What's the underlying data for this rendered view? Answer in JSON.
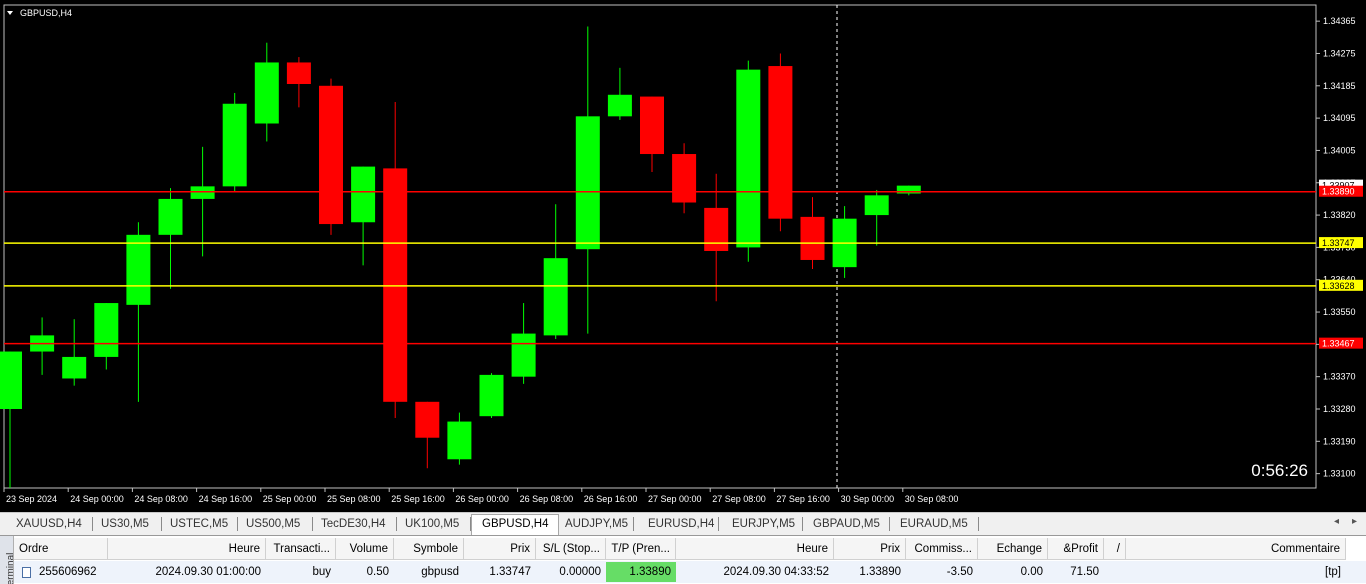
{
  "chart": {
    "symbol_title": "GBPUSD,H4",
    "countdown": "0:56:26",
    "colors": {
      "bull": "#00ff00",
      "bear": "#ff0000",
      "background": "#000000",
      "grid_text": "#ffffff",
      "hline_red": "#ff0000",
      "hline_yellow": "#ffff00"
    },
    "price_labels": [
      "1.34365",
      "1.34275",
      "1.34185",
      "1.34095",
      "1.34005",
      "1.33907",
      "1.33820",
      "1.33730",
      "1.33640",
      "1.33550",
      "1.33460",
      "1.33370",
      "1.33280",
      "1.33190",
      "1.33100"
    ],
    "time_labels": [
      "23 Sep 2024",
      "24 Sep 00:00",
      "24 Sep 08:00",
      "24 Sep 16:00",
      "25 Sep 00:00",
      "25 Sep 08:00",
      "25 Sep 16:00",
      "26 Sep 00:00",
      "26 Sep 08:00",
      "26 Sep 16:00",
      "27 Sep 00:00",
      "27 Sep 08:00",
      "27 Sep 16:00",
      "30 Sep 00:00",
      "30 Sep 08:00"
    ],
    "hlines": [
      {
        "price": 1.3389,
        "label": "1.33890",
        "color": "red"
      },
      {
        "price": 1.33747,
        "label": "1.33747",
        "color": "yellow"
      },
      {
        "price": 1.33628,
        "label": "1.33628",
        "color": "yellow"
      },
      {
        "price": 1.33467,
        "label": "1.33467",
        "color": "red"
      }
    ],
    "current_price_label": "1.33907",
    "candles": [
      {
        "o": 1.33285,
        "h": 1.33445,
        "l": 1.33065,
        "c": 1.33445
      },
      {
        "o": 1.33445,
        "h": 1.3354,
        "l": 1.3338,
        "c": 1.3349
      },
      {
        "o": 1.3337,
        "h": 1.33535,
        "l": 1.3335,
        "c": 1.3343
      },
      {
        "o": 1.3343,
        "h": 1.3358,
        "l": 1.33395,
        "c": 1.3358
      },
      {
        "o": 1.33575,
        "h": 1.33805,
        "l": 1.33305,
        "c": 1.3377
      },
      {
        "o": 1.3377,
        "h": 1.339,
        "l": 1.3362,
        "c": 1.3387
      },
      {
        "o": 1.3387,
        "h": 1.34015,
        "l": 1.3371,
        "c": 1.33905
      },
      {
        "o": 1.33905,
        "h": 1.34165,
        "l": 1.3389,
        "c": 1.34135
      },
      {
        "o": 1.3408,
        "h": 1.34305,
        "l": 1.3403,
        "c": 1.3425
      },
      {
        "o": 1.3425,
        "h": 1.34265,
        "l": 1.34125,
        "c": 1.3419
      },
      {
        "o": 1.34185,
        "h": 1.34205,
        "l": 1.3377,
        "c": 1.338
      },
      {
        "o": 1.33805,
        "h": 1.3396,
        "l": 1.33685,
        "c": 1.3396
      },
      {
        "o": 1.33955,
        "h": 1.3414,
        "l": 1.3326,
        "c": 1.33305
      },
      {
        "o": 1.33305,
        "h": 1.33305,
        "l": 1.3312,
        "c": 1.33205
      },
      {
        "o": 1.33145,
        "h": 1.33275,
        "l": 1.3313,
        "c": 1.3325
      },
      {
        "o": 1.33265,
        "h": 1.33385,
        "l": 1.3326,
        "c": 1.3338
      },
      {
        "o": 1.33375,
        "h": 1.3358,
        "l": 1.33355,
        "c": 1.33495
      },
      {
        "o": 1.3349,
        "h": 1.33855,
        "l": 1.3348,
        "c": 1.33705
      },
      {
        "o": 1.3373,
        "h": 1.3435,
        "l": 1.33495,
        "c": 1.341
      },
      {
        "o": 1.341,
        "h": 1.34235,
        "l": 1.3409,
        "c": 1.3416
      },
      {
        "o": 1.34155,
        "h": 1.34155,
        "l": 1.33945,
        "c": 1.33995
      },
      {
        "o": 1.33995,
        "h": 1.34025,
        "l": 1.3383,
        "c": 1.3386
      },
      {
        "o": 1.33845,
        "h": 1.3394,
        "l": 1.33585,
        "c": 1.33725
      },
      {
        "o": 1.33735,
        "h": 1.34255,
        "l": 1.33695,
        "c": 1.3423
      },
      {
        "o": 1.3424,
        "h": 1.34275,
        "l": 1.3378,
        "c": 1.33815
      },
      {
        "o": 1.3382,
        "h": 1.33875,
        "l": 1.33675,
        "c": 1.337
      },
      {
        "o": 1.3368,
        "h": 1.3385,
        "l": 1.3365,
        "c": 1.33815
      },
      {
        "o": 1.33825,
        "h": 1.33895,
        "l": 1.3374,
        "c": 1.3388
      },
      {
        "o": 1.33885,
        "h": 1.33907,
        "l": 1.3388,
        "c": 1.33907
      }
    ]
  },
  "tabs": [
    "XAUUSD,H4",
    "US30,M5",
    "USTEC,M5",
    "US500,M5",
    "TecDE30,H4",
    "UK100,M5",
    "GBPUSD,H4",
    "AUDJPY,M5",
    "EURUSD,H4",
    "EURJPY,M5",
    "GBPAUD,M5",
    "EURAUD,M5"
  ],
  "active_tab": "GBPUSD,H4",
  "terminal": {
    "side_label": "Terminal",
    "headers": [
      "Ordre",
      "Heure",
      "Transacti...",
      "Volume",
      "Symbole",
      "Prix",
      "S/L (Stop...",
      "T/P (Pren...",
      "Heure",
      "Prix",
      "Commiss...",
      "Echange",
      "&Profit",
      "/",
      "Commentaire"
    ],
    "row": {
      "order": "255606962",
      "open_time": "2024.09.30 01:00:00",
      "type": "buy",
      "volume": "0.50",
      "symbol": "gbpusd",
      "price": "1.33747",
      "sl": "0.00000",
      "tp": "1.33890",
      "time": "2024.09.30 04:33:52",
      "current_price": "1.33890",
      "commission": "-3.50",
      "swap": "0.00",
      "profit": "71.50",
      "comment": "[tp]"
    }
  }
}
